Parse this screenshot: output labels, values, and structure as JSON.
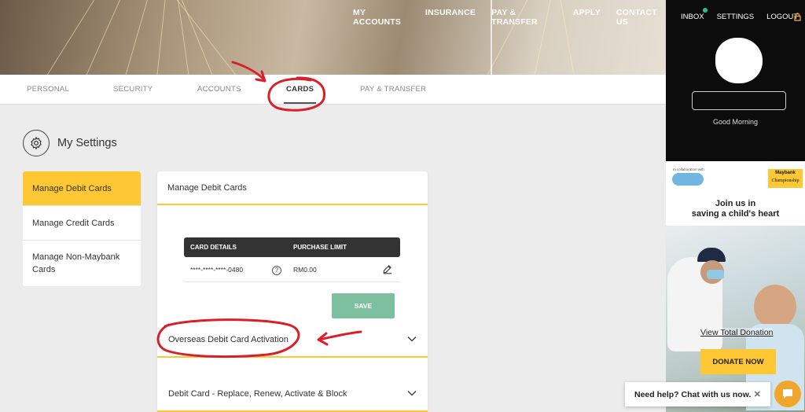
{
  "top_nav": [
    "MY ACCOUNTS",
    "INSURANCE",
    "PAY & TRANSFER",
    "APPLY",
    "CONTACT US"
  ],
  "sub_tabs": [
    "PERSONAL",
    "SECURITY",
    "ACCOUNTS",
    "CARDS",
    "PAY & TRANSFER"
  ],
  "active_sub_tab": "CARDS",
  "settings": {
    "title": "My Settings"
  },
  "side_menu": [
    "Manage Debit Cards",
    "Manage Credit Cards",
    "Manage Non-Maybank Cards"
  ],
  "panel": {
    "title": "Manage Debit Cards",
    "columns": [
      "CARD DETAILS",
      "PURCHASE LIMIT"
    ],
    "card_number": "****-****-****-0480",
    "purchase_limit": "RM0.00",
    "help_glyph": "?",
    "save_label": "SAVE",
    "accordions": [
      "Overseas Debit Card Activation",
      "Debit Card - Replace, Renew, Activate & Block"
    ]
  },
  "account_nav": [
    "INBOX",
    "SETTINGS",
    "LOGOUT"
  ],
  "greeting": "Good Morning",
  "ad": {
    "collab": "In collaboration with",
    "brand": "Maybank",
    "event": "Championship",
    "headline": [
      "Join us in",
      "saving a child's heart"
    ],
    "link": "View Total Donation",
    "cta": "DONATE NOW"
  },
  "chat": {
    "text": "Need help? Chat with us now.",
    "close": "✕"
  },
  "colors": {
    "accent_yellow": "#fdc833",
    "save_green": "#7dc0a0",
    "dark": "#0c0c0c",
    "annotation_red": "#d9202a",
    "chat_orange": "#f2a52b"
  },
  "icons": [
    "gear-icon",
    "edit-pencil-icon",
    "help-icon",
    "chevron-down-icon",
    "lock-icon",
    "chat-bubble-icon",
    "close-icon",
    "notification-dot"
  ]
}
